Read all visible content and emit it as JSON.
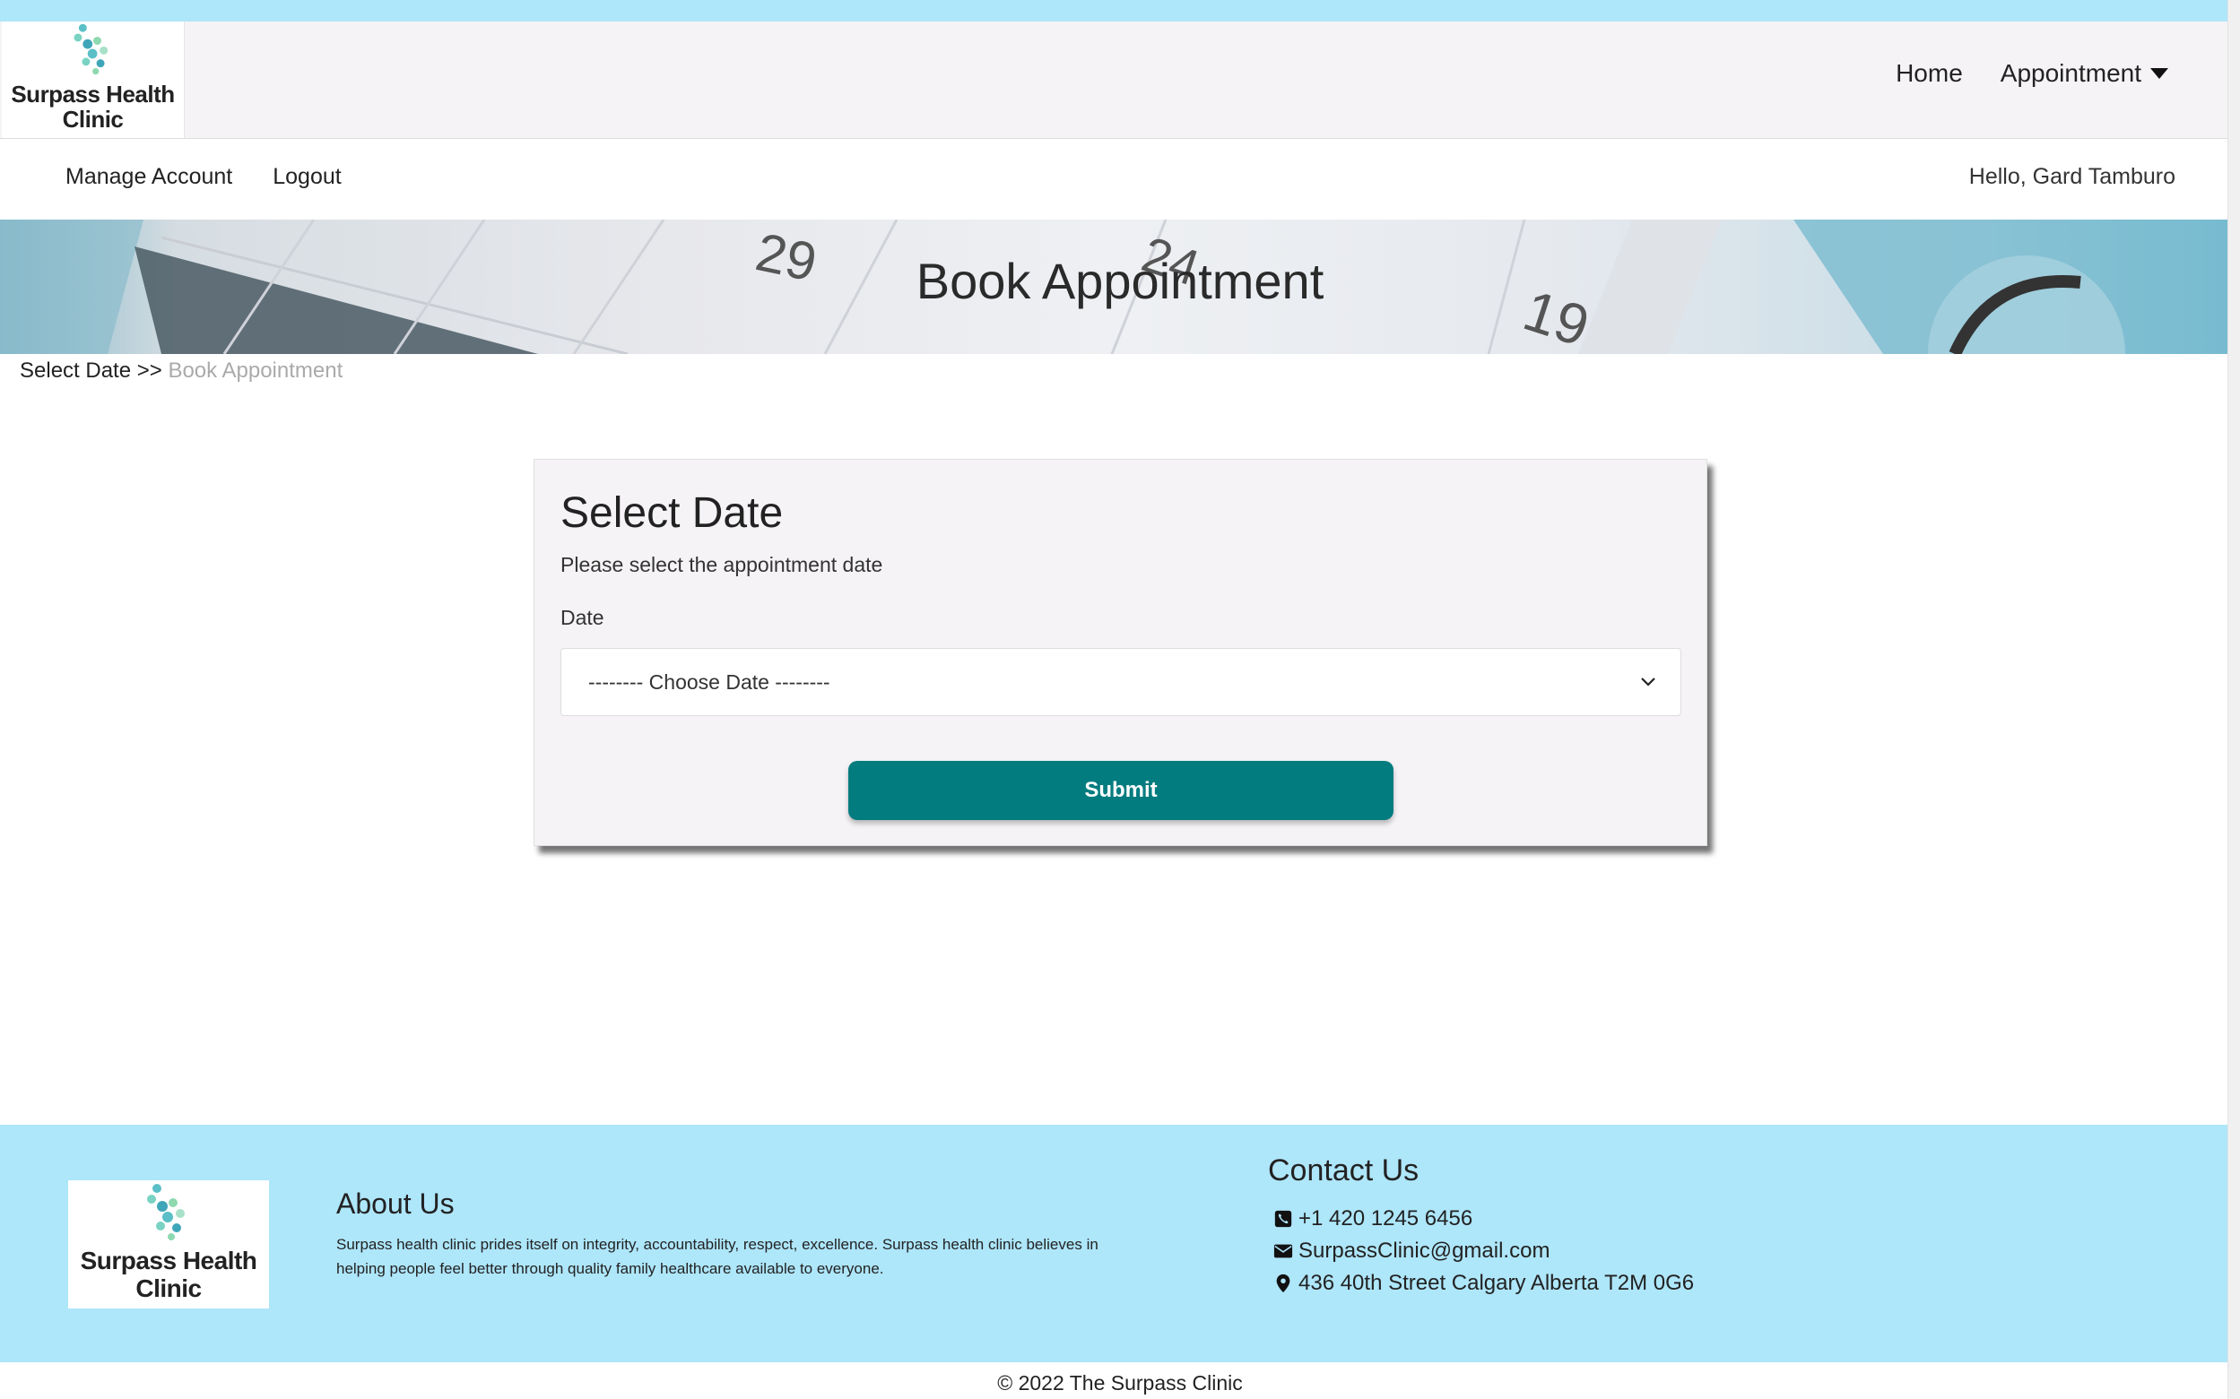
{
  "brand": {
    "logo_line1": "Surpass Health",
    "logo_line2": "Clinic"
  },
  "nav": {
    "home": "Home",
    "appointment": "Appointment"
  },
  "subnav": {
    "manage_account": "Manage Account",
    "logout": "Logout",
    "greeting": "Hello, Gard Tamburo"
  },
  "hero": {
    "title": "Book Appointment"
  },
  "breadcrumb": {
    "step1": "Select Date",
    "separator": ">>",
    "step2": "Book Appointment"
  },
  "card": {
    "title": "Select Date",
    "subtitle": "Please select the appointment date",
    "date_label": "Date",
    "date_selected": "-------- Choose Date --------",
    "submit_label": "Submit"
  },
  "footer": {
    "about_title": "About Us",
    "about_text": "Surpass health clinic prides itself on integrity, accountability, respect, excellence. Surpass health clinic believes in helping people feel better through quality family healthcare available to everyone.",
    "contact_title": "Contact Us",
    "phone": "+1 420 1245 6456",
    "email": "SurpassClinic@gmail.com",
    "address": "436 40th Street Calgary Alberta T2M 0G6"
  },
  "copyright": "© 2022 The Surpass Clinic",
  "colors": {
    "accent": "#037c80",
    "footer_bg": "#aee6fa",
    "navbar_bg": "#f5f3f6"
  },
  "icons": [
    "phone-icon",
    "envelope-icon",
    "map-marker-icon",
    "chevron-down-icon",
    "caret-down-icon"
  ]
}
